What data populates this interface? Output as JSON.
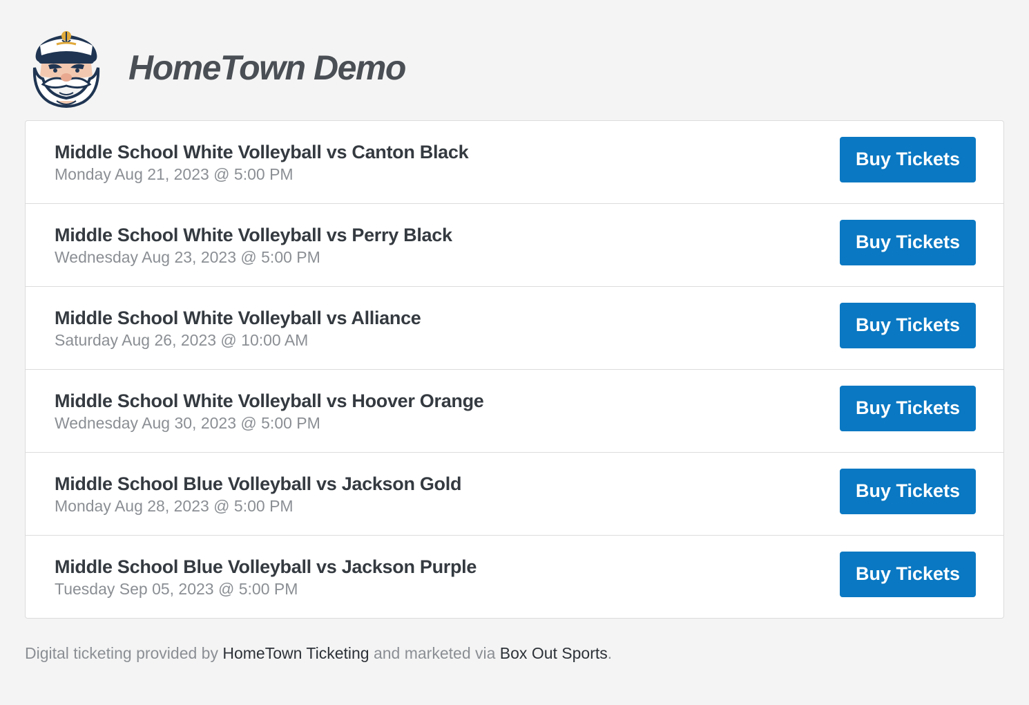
{
  "brand": {
    "title": "HomeTown Demo",
    "logo_icon": "captain-mascot-logo"
  },
  "events": [
    {
      "title": "Middle School White Volleyball vs Canton Black",
      "date": "Monday Aug 21, 2023 @ 5:00 PM",
      "button_label": "Buy Tickets"
    },
    {
      "title": "Middle School White Volleyball vs Perry Black",
      "date": "Wednesday Aug 23, 2023 @ 5:00 PM",
      "button_label": "Buy Tickets"
    },
    {
      "title": "Middle School White Volleyball vs Alliance",
      "date": "Saturday Aug 26, 2023 @ 10:00 AM",
      "button_label": "Buy Tickets"
    },
    {
      "title": "Middle School White Volleyball vs Hoover Orange",
      "date": "Wednesday Aug 30, 2023 @ 5:00 PM",
      "button_label": "Buy Tickets"
    },
    {
      "title": "Middle School Blue Volleyball vs Jackson Gold",
      "date": "Monday Aug 28, 2023 @ 5:00 PM",
      "button_label": "Buy Tickets"
    },
    {
      "title": "Middle School Blue Volleyball vs Jackson Purple",
      "date": "Tuesday Sep 05, 2023 @ 5:00 PM",
      "button_label": "Buy Tickets"
    }
  ],
  "footer": {
    "prefix": "Digital ticketing provided by ",
    "link1": "HomeTown Ticketing",
    "middle": " and marketed via ",
    "link2": "Box Out Sports",
    "suffix": "."
  },
  "colors": {
    "accent": "#0a78c2",
    "background": "#f4f4f4",
    "title_text": "#343a40",
    "muted_text": "#8b8f94"
  }
}
